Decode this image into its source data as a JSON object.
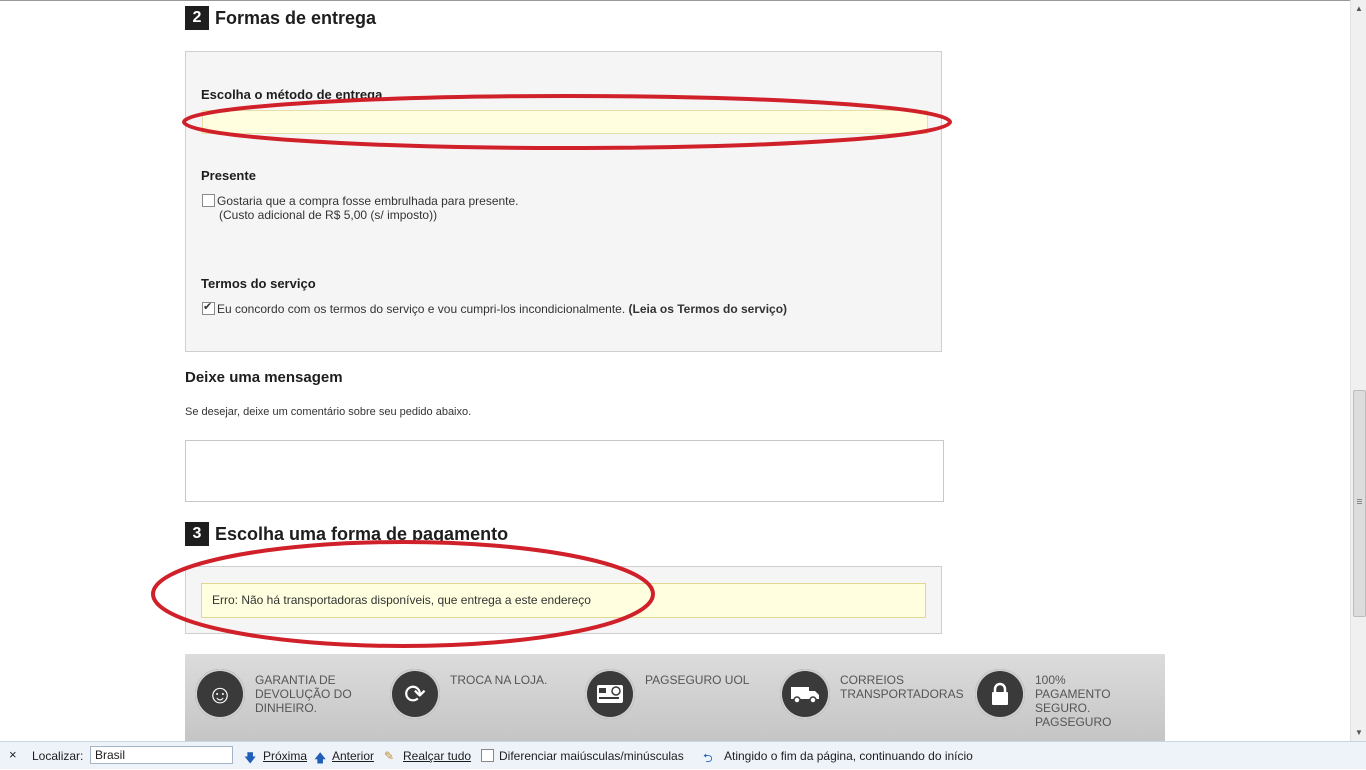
{
  "delivery": {
    "step_number": "2",
    "title": "Formas de entrega",
    "method_label": "Escolha o método de entrega",
    "gift_label": "Presente",
    "gift_checkbox_text": "Gostaria que a compra fosse embrulhada para presente.",
    "gift_cost_text": "(Custo adicional de R$ 5,00 (s/ imposto))",
    "gift_checked": false,
    "terms_label": "Termos do serviço",
    "terms_text": "Eu concordo com os termos do serviço e vou cumpri-los incondicionalmente.",
    "terms_link": "(Leia os Termos do serviço)",
    "terms_checked": true
  },
  "message": {
    "title": "Deixe uma mensagem",
    "subtitle": "Se desejar, deixe um comentário sobre seu pedido abaixo.",
    "value": ""
  },
  "payment": {
    "step_number": "3",
    "title": "Escolha uma forma de pagamento",
    "error": "Erro: Não há transportadoras disponíveis, que entrega a este endereço"
  },
  "badges": [
    {
      "icon": "smiley-icon",
      "text": "GARANTIA DE DEVOLUÇÃO DO DINHEIRO."
    },
    {
      "icon": "refresh-icon",
      "text": "TROCA NA LOJA."
    },
    {
      "icon": "card-icon",
      "text": "PAGSEGURO UOL"
    },
    {
      "icon": "truck-icon",
      "text": "CORREIOS TRANSPORTADORAS"
    },
    {
      "icon": "lock-icon",
      "text": "100% PAGAMENTO SEGURO. PAGSEGURO"
    }
  ],
  "findbar": {
    "close": "×",
    "label": "Localizar:",
    "value": "Brasil",
    "next": "Próxima",
    "previous": "Anterior",
    "highlight": "Realçar tudo",
    "match_case": "Diferenciar maiúsculas/minúsculas",
    "status": "Atingido o fim da página, continuando do início"
  },
  "colors": {
    "annotation_red": "#d0202a",
    "highlight_yellow": "#ffffe0"
  }
}
